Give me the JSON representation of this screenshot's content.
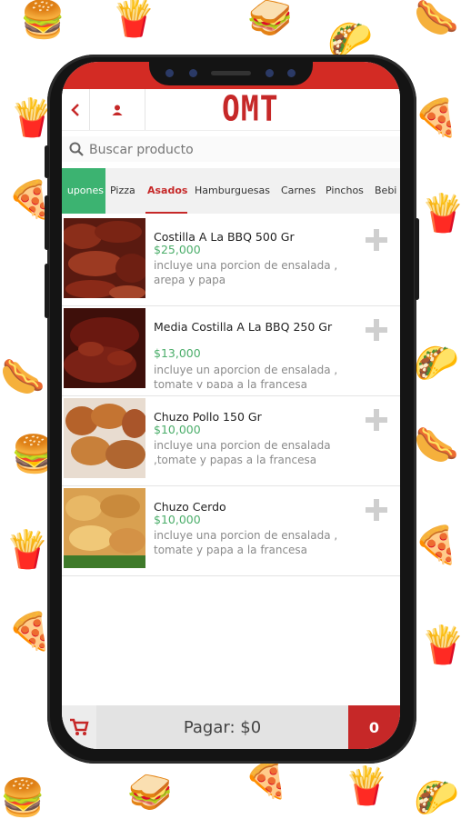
{
  "app": {
    "logo": "OMT",
    "accent": "#c62828",
    "green": "#3cb371"
  },
  "header": {
    "back_icon": "chevron-left-icon",
    "user_icon": "user-icon"
  },
  "search": {
    "placeholder": "Buscar producto",
    "icon": "search-icon"
  },
  "tabs": [
    {
      "label": "upones"
    },
    {
      "label": "Pizza"
    },
    {
      "label": "Asados",
      "active": true
    },
    {
      "label": "Hamburguesas"
    },
    {
      "label": "Carnes"
    },
    {
      "label": "Pinchos"
    },
    {
      "label": "Bebi"
    }
  ],
  "products": [
    {
      "name": "Costilla A La BBQ 500 Gr",
      "price": "$25,000",
      "description": "incluye una porcion de ensalada , arepa y papa"
    },
    {
      "name": "Media Costilla A La BBQ 250 Gr",
      "price": "$13,000",
      "description": "incluye un aporcion de ensalada , tomate y papa a la francesa"
    },
    {
      "name": "Chuzo Pollo 150 Gr",
      "price": "$10,000",
      "description": "incluye una porcion de ensalada ,tomate y papas a la francesa"
    },
    {
      "name": "Chuzo Cerdo",
      "price": "$10,000",
      "description": "incluye una porcion de ensalada , tomate y papa a la francesa"
    }
  ],
  "footer": {
    "cart_icon": "cart-icon",
    "pay_label": "Pagar: $0",
    "cart_count": "0"
  }
}
